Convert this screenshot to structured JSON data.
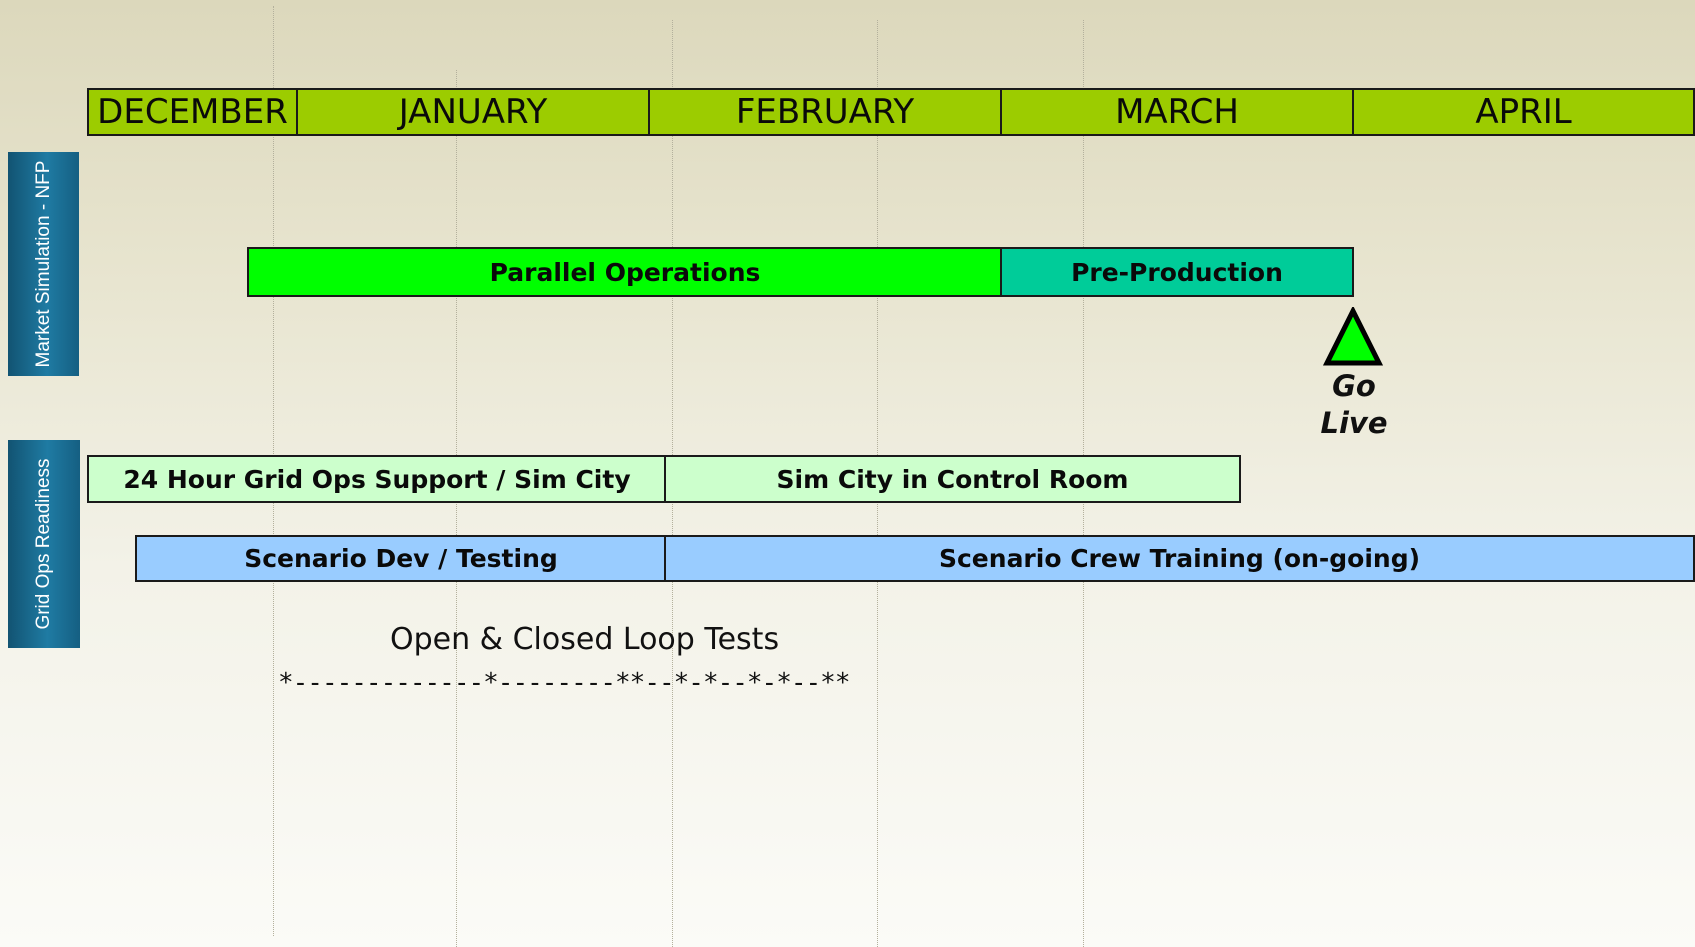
{
  "months": [
    "DECEMBER",
    "JANUARY",
    "FEBRUARY",
    "MARCH",
    "APRIL"
  ],
  "rows": {
    "market": {
      "label": "Market Simulation - NFP",
      "bars": [
        {
          "text": "Parallel Operations",
          "color": "#00ff00"
        },
        {
          "text": "Pre-Production",
          "color": "#00cc99"
        }
      ]
    },
    "gridops": {
      "label": "Grid Ops Readiness",
      "bars_row1": [
        {
          "text": "24 Hour Grid Ops Support / Sim City",
          "color": "#ccffcc"
        },
        {
          "text": "Sim City in Control Room",
          "color": "#ccffcc"
        }
      ],
      "bars_row2": [
        {
          "text": "Scenario Dev / Testing",
          "color": "#99ccff"
        },
        {
          "text": "Scenario Crew Training (on-going)",
          "color": "#99ccff"
        }
      ]
    }
  },
  "milestone": {
    "line1": "Go",
    "line2": "Live",
    "color": "#00ff00",
    "icon": "triangle-icon"
  },
  "tests": {
    "title": "Open & Closed Loop Tests",
    "pattern": "*-------------*--------**--*-*--*-*--**"
  },
  "colors": {
    "month_header": "#9ccc00",
    "side_label": "#1f6f94"
  }
}
